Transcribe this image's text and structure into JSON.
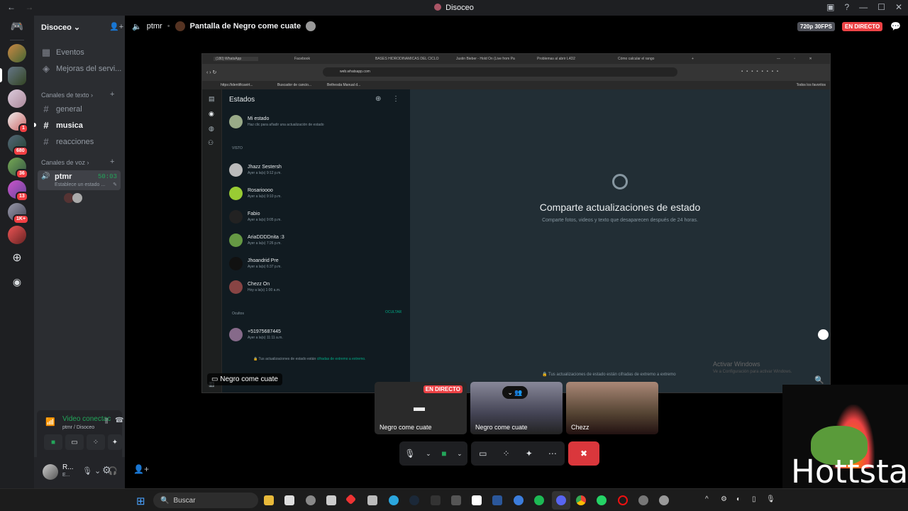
{
  "titlebar": {
    "title": "Disoceo",
    "back": "←",
    "forward": "→"
  },
  "server": {
    "name": "Disoceo"
  },
  "guild_badges": [
    "1",
    "680",
    "36",
    "13",
    "1K+"
  ],
  "sidebar": {
    "items": [
      {
        "label": "Eventos",
        "icon": "calendar-icon"
      },
      {
        "label": "Mejoras del servi..."
      }
    ],
    "text_category": "Canales de texto",
    "text_channels": [
      "general",
      "musica",
      "reacciones"
    ],
    "voice_category": "Canales de voz",
    "voice_channel": {
      "name": "ptmr",
      "time": "50:03",
      "status": "Establece un estado ..."
    }
  },
  "voice_panel": {
    "status": "Video conectac",
    "location": "ptmr / Disoceo"
  },
  "user_panel": {
    "name": "R...",
    "status": "E..."
  },
  "header": {
    "channel": "ptmr",
    "stream_title": "Pantalla de Negro come cuate",
    "quality": "720p 30FPS",
    "live": "EN DIRECTO"
  },
  "browser": {
    "tabs": [
      "(180) WhatsApp",
      "Facebook",
      "BASES HIDRODINAMICAS DEL CICLO",
      "Justin Bieber - Hold On (Live from Pa",
      "Problemas al abrir L4D2",
      "Cómo calcular el rango"
    ],
    "url": "web.whatsapp.com",
    "bookmarks": [
      "https://identificavirt...",
      "Buscador de cancio...",
      "Bethesda Manual d..."
    ],
    "favorites": "Todos los favoritos"
  },
  "whatsapp": {
    "title": "Estados",
    "my_status": {
      "name": "Mi estado",
      "sub": "Haz clic para añadir una actualización de estado"
    },
    "seen_label": "VISTO",
    "statuses": [
      {
        "name": "Jhazz Sestersh",
        "time": "Ayer a la(s) 9:12 p.m."
      },
      {
        "name": "Rosarioooo",
        "time": "Ayer a la(s) 9:10 p.m."
      },
      {
        "name": "Fabio",
        "time": "Ayer a la(s) 9:05 p.m."
      },
      {
        "name": "AriaDDDDnita :3",
        "time": "Ayer a la(s) 7:26 p.m."
      },
      {
        "name": "Jhoandrid Pre",
        "time": "Ayer a la(s) 6:37 p.m."
      },
      {
        "name": "Chezz On",
        "time": "Hoy a la(s) 1:00 a.m."
      }
    ],
    "hidden_label": "Ocultos",
    "hide_action": "OCULTAR",
    "hidden_status": {
      "name": "+51975687445",
      "time": "Ayer a la(s) 11:11 a.m."
    },
    "encryption_prefix": "Tus actualizaciones de estado están",
    "encryption_link": "cifradas de extremo a extremo.",
    "main_title": "Comparte actualizaciones de estado",
    "main_sub": "Comparte fotos, videos y texto que desaparecen después de 24 horas.",
    "main_footer": "Tus actualizaciones de estado están cifradas de extremo a extremo",
    "activate": "Activar Windows",
    "activate_sub": "Ve a Configuración para activar Windows."
  },
  "stream_label": "Negro come cuate",
  "tiles": [
    {
      "label": "Negro come cuate",
      "badge": "EN DIRECTO"
    },
    {
      "label": "Negro come cuate"
    },
    {
      "label": "Chezz"
    }
  ],
  "taskbar": {
    "search": "Buscar"
  },
  "overlay": {
    "text": "Hottstar"
  }
}
